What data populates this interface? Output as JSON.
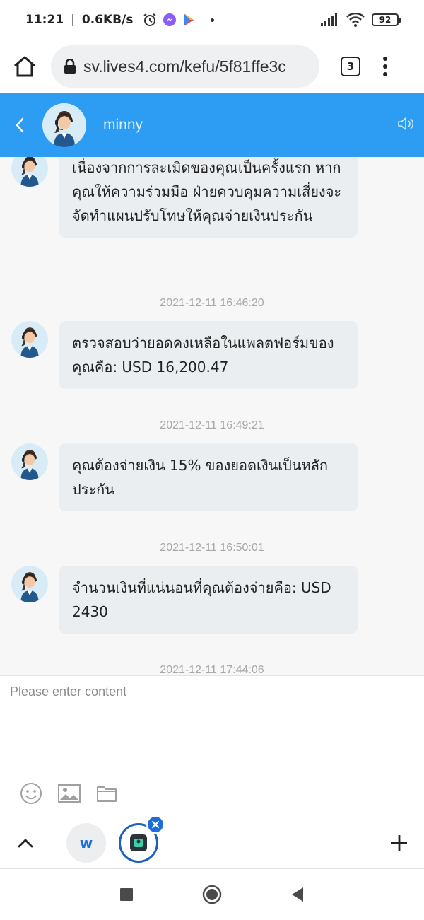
{
  "status_bar": {
    "time": "11:21",
    "net_speed": "0.6KB/s",
    "battery": "92"
  },
  "browser": {
    "url": "sv.lives4.com/kefu/5f81ffe3c",
    "tab_count": "3"
  },
  "chat_header": {
    "agent_name": "minny"
  },
  "messages": [
    {
      "text": "เนื่องจากการละเมิดของคุณเป็นครั้งแรก หากคุณให้ความร่วมมือ ฝ่ายควบคุมความเสี่ยงจะจัดทำแผนปรับโทษให้คุณจ่ายเงินประกัน"
    },
    {
      "timestamp": "2021-12-11 16:46:20",
      "text": "ตรวจสอบว่ายอดคงเหลือในแพลตฟอร์มของคุณคือ: USD 16,200.47"
    },
    {
      "timestamp": "2021-12-11 16:49:21",
      "text": "คุณต้องจ่ายเงิน 15% ของยอดเงินเป็นหลักประกัน"
    },
    {
      "timestamp": "2021-12-11 16:50:01",
      "text": "จำนวนเงินที่แน่นอนที่คุณต้องจ่ายคือ: USD 2430"
    }
  ],
  "partial_timestamp": "2021-12-11 17:44:06",
  "composer": {
    "placeholder": "Please enter content"
  },
  "bubble_bar": {
    "w_label": "w"
  },
  "colors": {
    "header_blue": "#2d9cf3",
    "bubble_bg": "#eaeef0",
    "chat_bg": "#f7f7f7"
  }
}
